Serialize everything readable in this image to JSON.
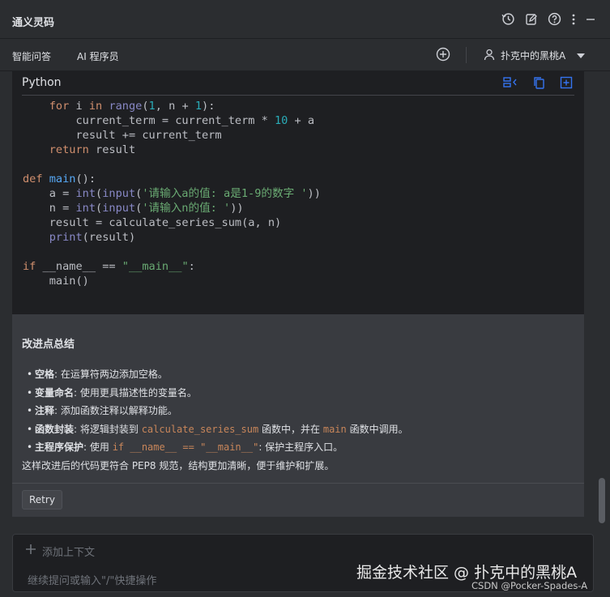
{
  "app": {
    "title": "通义灵码"
  },
  "tabs": [
    {
      "label": "智能问答",
      "active": true
    },
    {
      "label": "AI 程序员",
      "active": false
    }
  ],
  "user": {
    "name": "扑克中的黑桃A"
  },
  "code_block": {
    "language": "Python"
  },
  "summary": {
    "heading": "改进点总结",
    "items": [
      {
        "term": "空格",
        "desc": ": 在运算符两边添加空格。"
      },
      {
        "term": "变量命名",
        "desc": ": 使用更具描述性的变量名。"
      },
      {
        "term": "注释",
        "desc": ": 添加函数注释以解释功能。"
      },
      {
        "term": "函数封装",
        "desc_a": ": 将逻辑封装到 ",
        "code_a": "calculate_series_sum",
        "desc_b": " 函数中，并在 ",
        "code_b": "main",
        "desc_c": " 函数中调用。"
      },
      {
        "term": "主程序保护",
        "desc_a": ": 使用 ",
        "code_a": "if __name__ == \"__main__\"",
        "desc_b": ": 保护主程序入口。"
      }
    ],
    "conclusion": "这样改进后的代码更符合 PEP8 规范，结构更加清晰，便于维护和扩展。"
  },
  "retry_label": "Retry",
  "input": {
    "add_context_label": "添加上下文",
    "placeholder": "继续提问或输入\"/\"快捷操作"
  },
  "watermark": {
    "line1": "掘金技术社区 @ 扑克中的黑桃A",
    "line2": "CSDN @Pocker-Spades-A"
  },
  "colors": {
    "accent": "#3574f0",
    "background": "#2b2d30",
    "code_bg": "#1e1f22",
    "keyword": "#cf8e6d",
    "number": "#2aacb8",
    "string": "#6aab73"
  }
}
